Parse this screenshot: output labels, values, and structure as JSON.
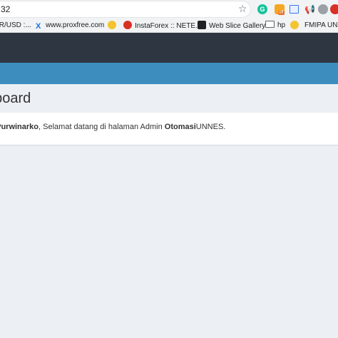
{
  "browser": {
    "url_fragment": "32",
    "bookmarks": [
      {
        "label": "IR/USD :...",
        "icon": "currency-icon",
        "color": "#ffffff"
      },
      {
        "label": "www.proxfree.com",
        "icon": "proxfree-icon",
        "color": "#1a73e8"
      },
      {
        "label": "",
        "icon": "emoji-icon",
        "color": "#f4c430"
      },
      {
        "label": "InstaForex :: NETE...",
        "icon": "instaforex-icon",
        "color": "#d93025"
      },
      {
        "label": "Web Slice Gallery",
        "icon": "webslice-icon",
        "color": "#202124"
      },
      {
        "label": "hp",
        "icon": "folder-icon",
        "color": "#5f6368"
      },
      {
        "label": "",
        "icon": "emoji-icon",
        "color": "#f4c430"
      },
      {
        "label": "FMIPA UNNES",
        "icon": "folder-icon",
        "color": "#5f6368"
      }
    ]
  },
  "app": {
    "page_title": "hboard",
    "welcome": {
      "name": "i Purwinarko",
      "middle": ", Selamat datang di halaman Admin ",
      "brand_bold": "Otomasi",
      "brand_rest": "UNNES."
    }
  },
  "colors": {
    "navbar_dark": "#2e3741",
    "navbar_blue": "#3d8ebf",
    "content_bg": "#ecf0f5"
  }
}
